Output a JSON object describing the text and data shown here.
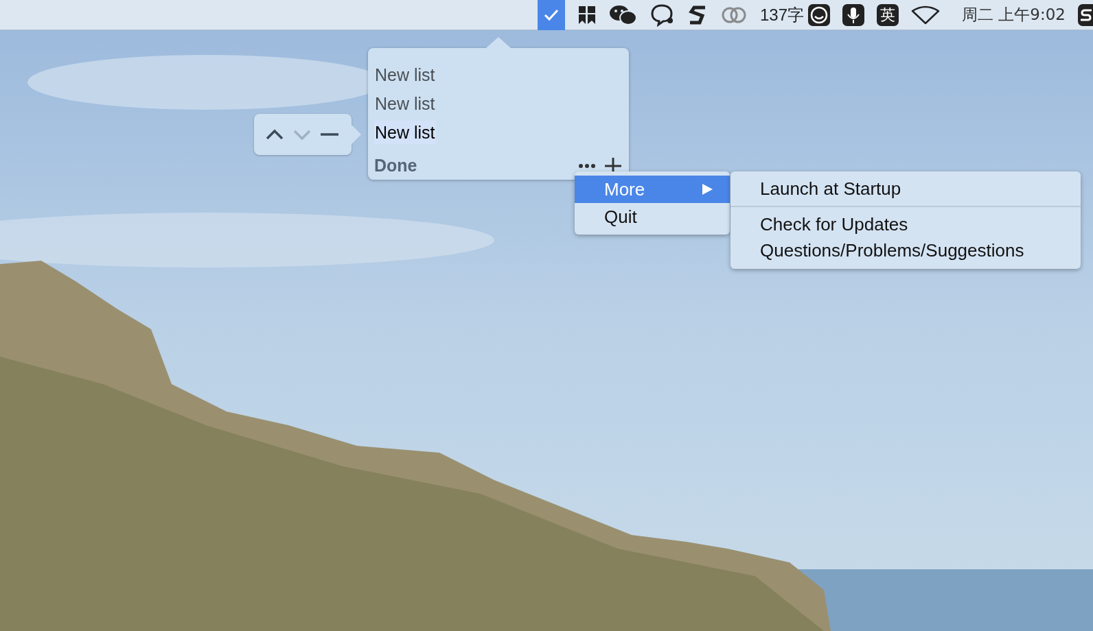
{
  "menu_bar": {
    "app_status_item": {
      "active": true
    },
    "word_count": "137字",
    "input_method": "英",
    "clock": "周二 上午9:02"
  },
  "reorder_popover": {
    "controls": [
      {
        "kind": "up",
        "disabled": false
      },
      {
        "kind": "down",
        "disabled": true
      },
      {
        "kind": "remove",
        "disabled": false
      }
    ]
  },
  "lists_popover": {
    "lists": [
      {
        "name": "New list",
        "selected": false
      },
      {
        "name": "New list",
        "selected": false
      },
      {
        "name": "New list",
        "selected": true
      }
    ],
    "footer": "Done"
  },
  "context_menu": {
    "items": [
      {
        "label": "More",
        "selected": true,
        "submenu": true
      },
      {
        "label": "Quit",
        "selected": false,
        "submenu": false
      }
    ]
  },
  "submenu": {
    "sections": [
      [
        "Launch at Startup"
      ],
      [
        "Check for Updates",
        "Questions/Problems/Suggestions"
      ]
    ]
  }
}
